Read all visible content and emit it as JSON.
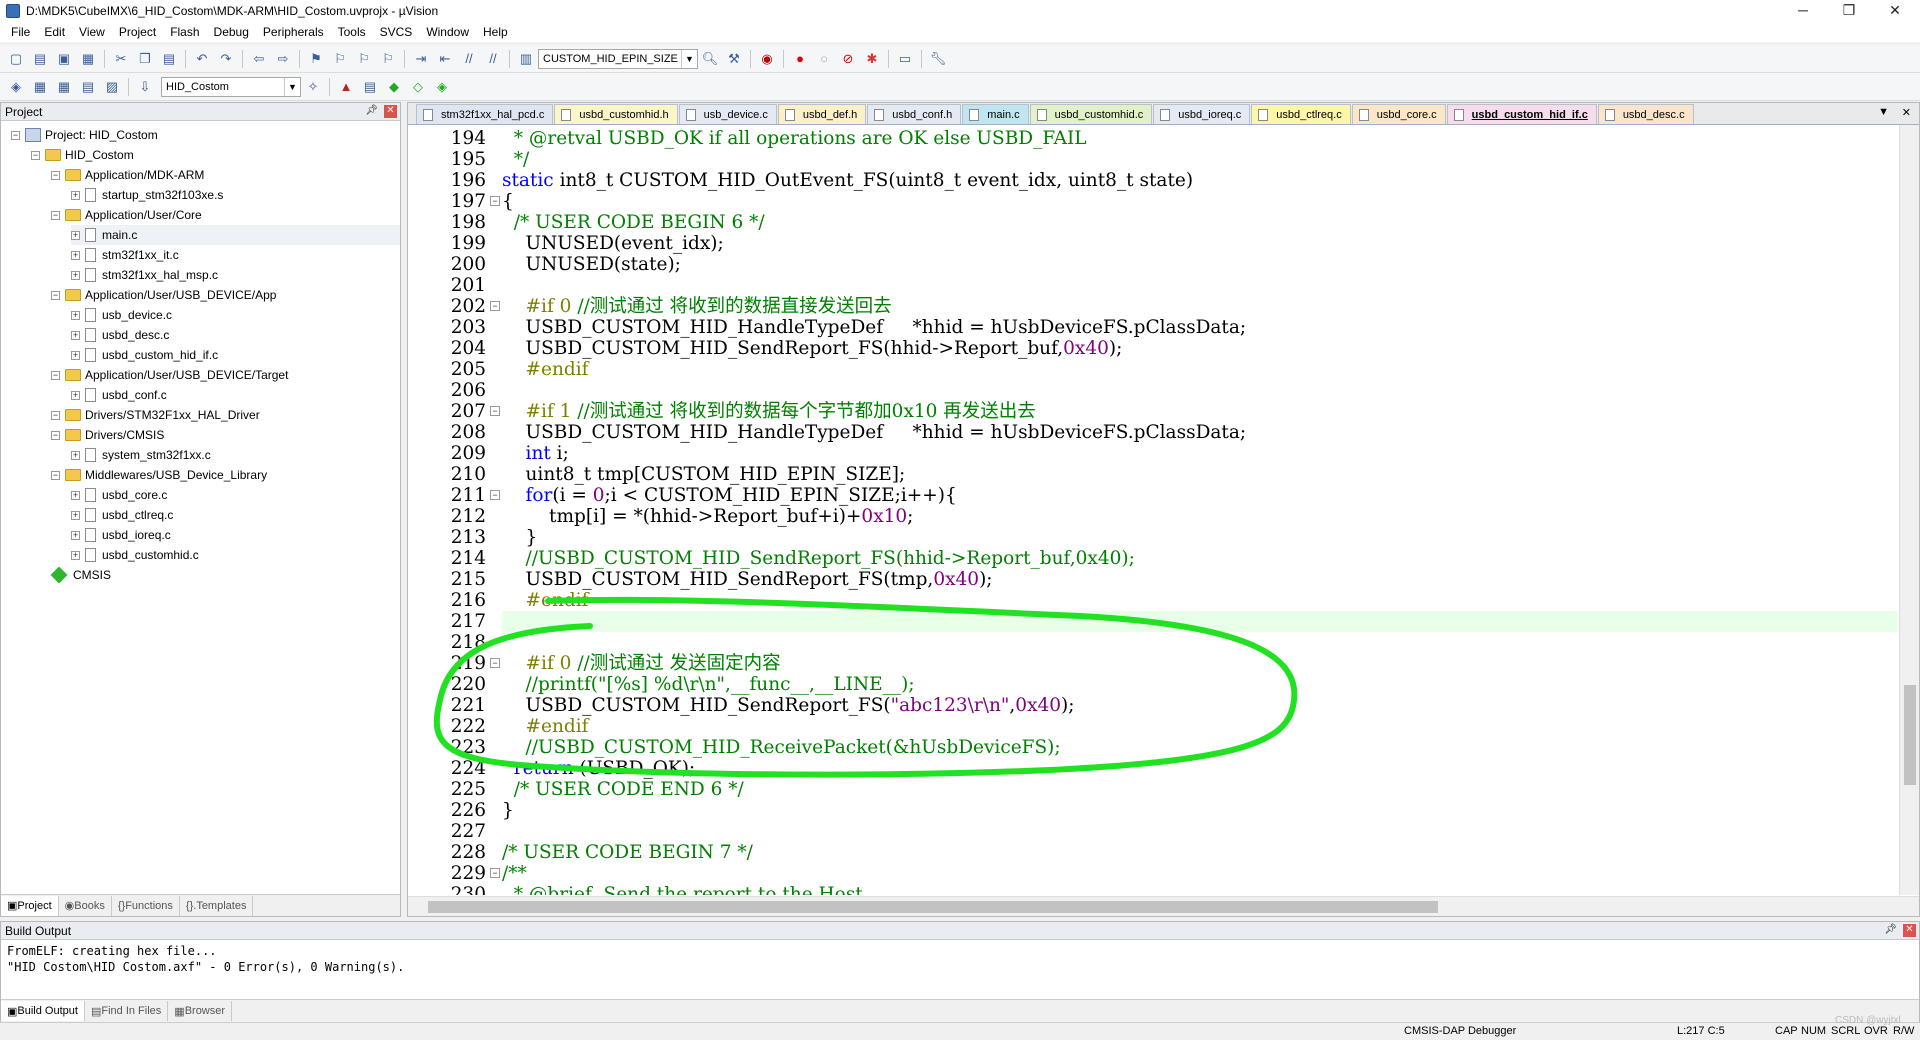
{
  "window": {
    "title": "D:\\MDK5\\CubeIMX\\6_HID_Costom\\MDK-ARM\\HID_Costom.uvprojx - µVision"
  },
  "menu": [
    "File",
    "Edit",
    "View",
    "Project",
    "Flash",
    "Debug",
    "Peripherals",
    "Tools",
    "SVCS",
    "Window",
    "Help"
  ],
  "toolbar": {
    "combo1": "CUSTOM_HID_EPIN_SIZE",
    "target_combo": "HID_Costom"
  },
  "project_pane": {
    "title": "Project",
    "tree": [
      {
        "label": "Project: HID_Costom",
        "kind": "project"
      },
      {
        "label": "HID_Costom",
        "kind": "folder"
      },
      {
        "label": "Application/MDK-ARM",
        "kind": "folder"
      },
      {
        "label": "startup_stm32f103xe.s",
        "kind": "file"
      },
      {
        "label": "Application/User/Core",
        "kind": "folder"
      },
      {
        "label": "main.c",
        "kind": "file"
      },
      {
        "label": "stm32f1xx_it.c",
        "kind": "file"
      },
      {
        "label": "stm32f1xx_hal_msp.c",
        "kind": "file"
      },
      {
        "label": "Application/User/USB_DEVICE/App",
        "kind": "folder"
      },
      {
        "label": "usb_device.c",
        "kind": "file"
      },
      {
        "label": "usbd_desc.c",
        "kind": "file"
      },
      {
        "label": "usbd_custom_hid_if.c",
        "kind": "file"
      },
      {
        "label": "Application/User/USB_DEVICE/Target",
        "kind": "folder"
      },
      {
        "label": "usbd_conf.c",
        "kind": "file"
      },
      {
        "label": "Drivers/STM32F1xx_HAL_Driver",
        "kind": "folder"
      },
      {
        "label": "Drivers/CMSIS",
        "kind": "folder"
      },
      {
        "label": "system_stm32f1xx.c",
        "kind": "file"
      },
      {
        "label": "Middlewares/USB_Device_Library",
        "kind": "folder"
      },
      {
        "label": "usbd_core.c",
        "kind": "file"
      },
      {
        "label": "usbd_ctlreq.c",
        "kind": "file"
      },
      {
        "label": "usbd_ioreq.c",
        "kind": "file"
      },
      {
        "label": "usbd_customhid.c",
        "kind": "file"
      },
      {
        "label": "CMSIS",
        "kind": "component"
      }
    ],
    "tabs": [
      "Project",
      "Books",
      "Functions",
      "Templates"
    ]
  },
  "editor": {
    "tabs": [
      {
        "label": "stm32f1xx_hal_pcd.c",
        "color": "#dfe6f2"
      },
      {
        "label": "usbd_customhid.h",
        "color": "#fbf6c8"
      },
      {
        "label": "usb_device.c",
        "color": "#e4e9f2"
      },
      {
        "label": "usbd_def.h",
        "color": "#fbf0c8"
      },
      {
        "label": "usbd_conf.h",
        "color": "#e4e9f2"
      },
      {
        "label": "main.c",
        "color": "#bfe6ef"
      },
      {
        "label": "usbd_customhid.c",
        "color": "#e2f2c8"
      },
      {
        "label": "usbd_ioreq.c",
        "color": "#e4e9f2"
      },
      {
        "label": "usbd_ctlreq.c",
        "color": "#fbf6a8"
      },
      {
        "label": "usbd_core.c",
        "color": "#fbe6c8"
      },
      {
        "label": "usbd_custom_hid_if.c",
        "color": "#f6dcec"
      },
      {
        "label": "usbd_desc.c",
        "color": "#fbe4cc"
      }
    ],
    "active_tab": 10,
    "lines": [
      {
        "n": "194",
        "m": "",
        "segs": [
          [
            "c-cm",
            "  * @retval USBD_OK if all operations are OK else USBD_FAIL"
          ]
        ]
      },
      {
        "n": "195",
        "m": "",
        "segs": [
          [
            "c-cm",
            "  */"
          ]
        ]
      },
      {
        "n": "196",
        "m": "",
        "segs": [
          [
            "c-kw",
            "static "
          ],
          [
            "c-tx",
            "int8_t CUSTOM_HID_OutEvent_FS(uint8_t event_idx, uint8_t state)"
          ]
        ]
      },
      {
        "n": "197",
        "m": "-",
        "segs": [
          [
            "c-tx",
            "{"
          ]
        ]
      },
      {
        "n": "198",
        "m": "",
        "segs": [
          [
            "c-cm",
            "  /* USER CODE BEGIN 6 */"
          ]
        ]
      },
      {
        "n": "199",
        "m": "",
        "segs": [
          [
            "c-tx",
            "    UNUSED(event_idx);"
          ]
        ]
      },
      {
        "n": "200",
        "m": "",
        "segs": [
          [
            "c-tx",
            "    UNUSED(state);"
          ]
        ]
      },
      {
        "n": "201",
        "m": "",
        "segs": [
          [
            "c-tx",
            ""
          ]
        ]
      },
      {
        "n": "202",
        "m": "-",
        "segs": [
          [
            "c-pp",
            "    #if 0 "
          ],
          [
            "c-cm",
            "//测试通过 将收到的数据直接发送回去"
          ]
        ]
      },
      {
        "n": "203",
        "m": "",
        "segs": [
          [
            "c-tx",
            "    USBD_CUSTOM_HID_HandleTypeDef     *hhid = hUsbDeviceFS.pClassData;"
          ]
        ]
      },
      {
        "n": "204",
        "m": "",
        "segs": [
          [
            "c-tx",
            "    USBD_CUSTOM_HID_SendReport_FS(hhid->Report_buf,"
          ],
          [
            "c-nm",
            "0x40"
          ],
          [
            "c-tx",
            ");"
          ]
        ]
      },
      {
        "n": "205",
        "m": "",
        "segs": [
          [
            "c-pp",
            "    #endif"
          ]
        ]
      },
      {
        "n": "206",
        "m": "",
        "segs": [
          [
            "c-tx",
            ""
          ]
        ]
      },
      {
        "n": "207",
        "m": "-",
        "segs": [
          [
            "c-pp",
            "    #if 1 "
          ],
          [
            "c-cm",
            "//测试通过 将收到的数据每个字节都加0x10 再发送出去"
          ]
        ]
      },
      {
        "n": "208",
        "m": "",
        "segs": [
          [
            "c-tx",
            "    USBD_CUSTOM_HID_HandleTypeDef     *hhid = hUsbDeviceFS.pClassData;"
          ]
        ]
      },
      {
        "n": "209",
        "m": "",
        "segs": [
          [
            "c-kw",
            "    int "
          ],
          [
            "c-tx",
            "i;"
          ]
        ]
      },
      {
        "n": "210",
        "m": "",
        "segs": [
          [
            "c-tx",
            "    uint8_t tmp[CUSTOM_HID_EPIN_SIZE];"
          ]
        ]
      },
      {
        "n": "211",
        "m": "-",
        "segs": [
          [
            "c-kw",
            "    for"
          ],
          [
            "c-tx",
            "(i = "
          ],
          [
            "c-nm",
            "0"
          ],
          [
            "c-tx",
            ";i < CUSTOM_HID_EPIN_SIZE;i++){"
          ]
        ]
      },
      {
        "n": "212",
        "m": "",
        "segs": [
          [
            "c-tx",
            "        tmp[i] = *(hhid->Report_buf+i)+"
          ],
          [
            "c-nm",
            "0x10"
          ],
          [
            "c-tx",
            ";"
          ]
        ]
      },
      {
        "n": "213",
        "m": "",
        "segs": [
          [
            "c-tx",
            "    }"
          ]
        ]
      },
      {
        "n": "214",
        "m": "",
        "segs": [
          [
            "c-cm",
            "    //USBD_CUSTOM_HID_SendReport_FS(hhid->Report_buf,0x40);"
          ]
        ]
      },
      {
        "n": "215",
        "m": "",
        "segs": [
          [
            "c-tx",
            "    USBD_CUSTOM_HID_SendReport_FS(tmp,"
          ],
          [
            "c-nm",
            "0x40"
          ],
          [
            "c-tx",
            ");"
          ]
        ]
      },
      {
        "n": "216",
        "m": "",
        "segs": [
          [
            "c-pp",
            "    #endif"
          ]
        ]
      },
      {
        "n": "217",
        "m": "",
        "segs": [
          [
            "c-tx",
            ""
          ]
        ],
        "hl": true
      },
      {
        "n": "218",
        "m": "",
        "segs": [
          [
            "c-tx",
            ""
          ]
        ]
      },
      {
        "n": "219",
        "m": "-",
        "segs": [
          [
            "c-pp",
            "    #if 0 "
          ],
          [
            "c-cm",
            "//测试通过 发送固定内容"
          ]
        ]
      },
      {
        "n": "220",
        "m": "",
        "segs": [
          [
            "c-cm",
            "    //printf(\"[%s] %d\\r\\n\",__func__,__LINE__);"
          ]
        ]
      },
      {
        "n": "221",
        "m": "",
        "segs": [
          [
            "c-tx",
            "    USBD_CUSTOM_HID_SendReport_FS("
          ],
          [
            "c-st",
            "\"abc123\\r\\n\""
          ],
          [
            "c-tx",
            ","
          ],
          [
            "c-nm",
            "0x40"
          ],
          [
            "c-tx",
            ");"
          ]
        ]
      },
      {
        "n": "222",
        "m": "",
        "segs": [
          [
            "c-pp",
            "    #endif"
          ]
        ]
      },
      {
        "n": "223",
        "m": "",
        "segs": [
          [
            "c-cm",
            "    //USBD_CUSTOM_HID_ReceivePacket(&hUsbDeviceFS);"
          ]
        ]
      },
      {
        "n": "224",
        "m": "",
        "segs": [
          [
            "c-kw",
            "  return "
          ],
          [
            "c-tx",
            "(USBD_OK);"
          ]
        ]
      },
      {
        "n": "225",
        "m": "",
        "segs": [
          [
            "c-cm",
            "  /* USER CODE END 6 */"
          ]
        ]
      },
      {
        "n": "226",
        "m": "",
        "segs": [
          [
            "c-tx",
            "}"
          ]
        ]
      },
      {
        "n": "227",
        "m": "",
        "segs": [
          [
            "c-tx",
            ""
          ]
        ]
      },
      {
        "n": "228",
        "m": "",
        "segs": [
          [
            "c-cm",
            "/* USER CODE BEGIN 7 */"
          ]
        ]
      },
      {
        "n": "229",
        "m": "-",
        "segs": [
          [
            "c-cm",
            "/**"
          ]
        ]
      },
      {
        "n": "230",
        "m": "",
        "segs": [
          [
            "c-cm",
            "  * @brief  Send the report to the Host"
          ]
        ]
      }
    ]
  },
  "build_output": {
    "title": "Build Output",
    "lines": [
      "FromELF: creating hex file...",
      "\"HID Costom\\HID Costom.axf\" - 0 Error(s), 0 Warning(s)."
    ],
    "tabs": [
      "Build Output",
      "Find In Files",
      "Browser"
    ]
  },
  "status": {
    "debugger": "CMSIS-DAP Debugger",
    "position": "L:217 C:5",
    "caps": "CAP",
    "num": "NUM",
    "scrl": "SCRL",
    "ovr": "OVR",
    "rw": "R/W",
    "watermark": "CSDN @wyjtxl"
  }
}
